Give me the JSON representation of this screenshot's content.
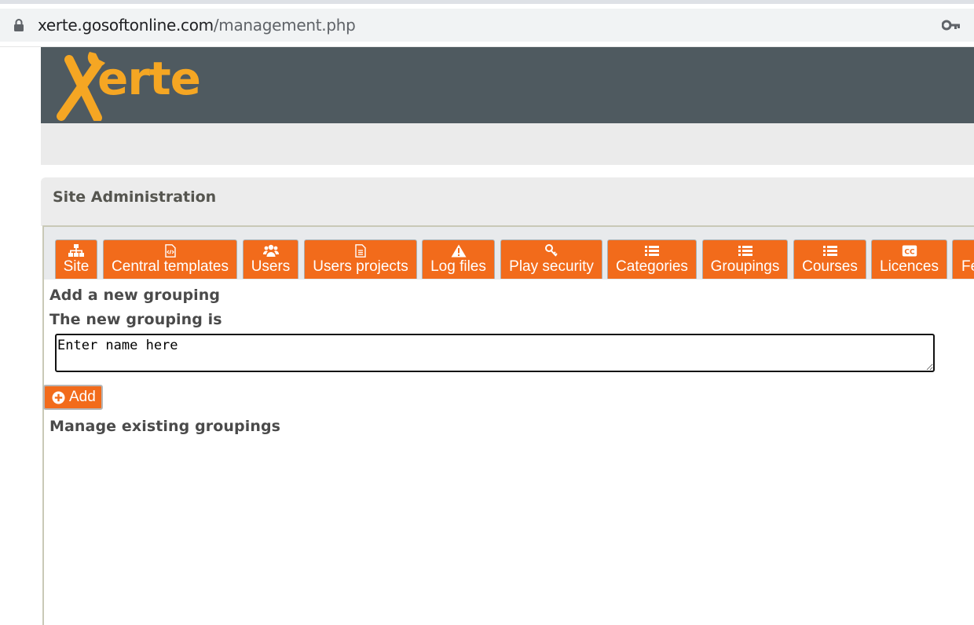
{
  "browser": {
    "url_host": "xerte.gosoftonline.com",
    "url_path": "/management.php"
  },
  "header": {
    "logo_text": "Xerte"
  },
  "admin": {
    "title": "Site Administration"
  },
  "tabs": [
    {
      "label": "Site",
      "icon": "sitemap-icon"
    },
    {
      "label": "Central templates",
      "icon": "code-file-icon"
    },
    {
      "label": "Users",
      "icon": "users-icon"
    },
    {
      "label": "Users projects",
      "icon": "text-file-icon"
    },
    {
      "label": "Log files",
      "icon": "warning-icon"
    },
    {
      "label": "Play security",
      "icon": "key-icon"
    },
    {
      "label": "Categories",
      "icon": "list-icon"
    },
    {
      "label": "Groupings",
      "icon": "list-icon"
    },
    {
      "label": "Courses",
      "icon": "list-icon"
    },
    {
      "label": "Licences",
      "icon": "cc-icon"
    },
    {
      "label": "Fe",
      "icon": ""
    }
  ],
  "grouping": {
    "add_heading": "Add a new grouping",
    "field_label": "The new grouping is",
    "field_value": "Enter name here",
    "add_button": "Add",
    "manage_heading": "Manage existing groupings"
  },
  "colors": {
    "accent_orange": "#f26b1b",
    "header_bg": "#4f5a60",
    "logo_orange": "#f5a623"
  }
}
